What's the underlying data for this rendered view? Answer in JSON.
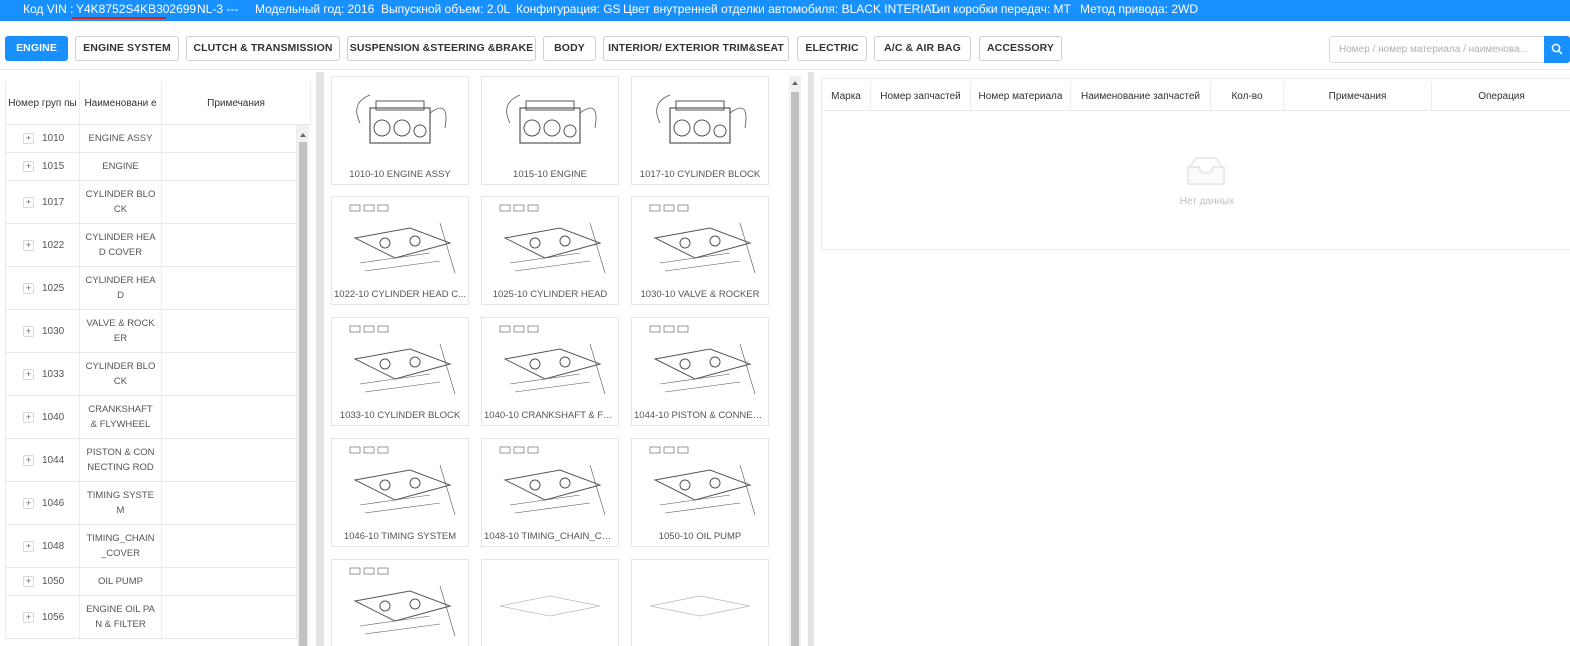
{
  "info_bar": {
    "vin_label": "Код VIN :",
    "vin": "Y4K8752S4KB302699",
    "model_code": "NL-3 ---",
    "model_year": "Модельный год: 2016",
    "displacement": "Выпускной объем: 2.0L",
    "configuration": "Конфигурация: GS",
    "interior_color": "Цвет внутренней отделки автомобиля: BLACK INTERIAL",
    "transmission": "Тип коробки передач: MT",
    "drive": "Метод привода: 2WD"
  },
  "tabs": [
    {
      "label": "ENGINE",
      "active": true
    },
    {
      "label": "ENGINE SYSTEM"
    },
    {
      "label": "CLUTCH & TRANSMISSION"
    },
    {
      "label": "SUSPENSION &STEERING &BRAKE"
    },
    {
      "label": "BODY"
    },
    {
      "label": "INTERIOR/ EXTERIOR TRIM&SEAT"
    },
    {
      "label": "ELECTRIC"
    },
    {
      "label": "A/C & AIR BAG"
    },
    {
      "label": "ACCESSORY"
    }
  ],
  "search": {
    "placeholder": "Номер / номер материала / наименова..."
  },
  "groups": {
    "columns": [
      "Номер груп пы",
      "Наименовани е",
      "Примечания"
    ],
    "rows": [
      {
        "code": "1010",
        "name": "ENGINE ASSY"
      },
      {
        "code": "1015",
        "name": "ENGINE"
      },
      {
        "code": "1017",
        "name": "CYLINDER BLO CK"
      },
      {
        "code": "1022",
        "name": "CYLINDER HEA D COVER"
      },
      {
        "code": "1025",
        "name": "CYLINDER HEA D"
      },
      {
        "code": "1030",
        "name": "VALVE & ROCK ER"
      },
      {
        "code": "1033",
        "name": "CYLINDER BLO CK"
      },
      {
        "code": "1040",
        "name": "CRANKSHAFT & FLYWHEEL"
      },
      {
        "code": "1044",
        "name": "PISTON & CON NECTING ROD"
      },
      {
        "code": "1046",
        "name": "TIMING SYSTE M"
      },
      {
        "code": "1048",
        "name": "TIMING_CHAIN _COVER"
      },
      {
        "code": "1050",
        "name": "OIL PUMP"
      },
      {
        "code": "1056",
        "name": "ENGINE OIL PA N & FILTER"
      }
    ]
  },
  "diagrams": [
    {
      "caption": "1010-10 ENGINE ASSY",
      "icon": "engine-assembly-diagram"
    },
    {
      "caption": "1015-10 ENGINE",
      "icon": "engine-diagram"
    },
    {
      "caption": "1017-10 CYLINDER BLOCK",
      "icon": "cylinder-block-diagram"
    },
    {
      "caption": "1022-10 CYLINDER HEAD C...",
      "icon": "cylinder-head-cover-diagram"
    },
    {
      "caption": "1025-10 CYLINDER HEAD",
      "icon": "cylinder-head-diagram"
    },
    {
      "caption": "1030-10 VALVE & ROCKER",
      "icon": "valve-rocker-diagram"
    },
    {
      "caption": "1033-10 CYLINDER BLOCK",
      "icon": "cylinder-block-exploded-diagram"
    },
    {
      "caption": "1040-10 CRANKSHAFT & FL...",
      "icon": "crankshaft-diagram"
    },
    {
      "caption": "1044-10 PISTON & CONNEC...",
      "icon": "piston-diagram"
    },
    {
      "caption": "1046-10 TIMING SYSTEM",
      "icon": "timing-system-diagram"
    },
    {
      "caption": "1048-10 TIMING_CHAIN_CO...",
      "icon": "timing-chain-cover-diagram"
    },
    {
      "caption": "1050-10 OIL PUMP",
      "icon": "oil-pump-diagram"
    },
    {
      "caption": "",
      "icon": "oil-pan-diagram"
    },
    {
      "caption": "",
      "icon": "diagram-partial"
    },
    {
      "caption": "",
      "icon": "diagram-partial"
    }
  ],
  "parts": {
    "columns": [
      "Марка",
      "Номер запчастей",
      "Номер материала",
      "Наименование запчастей",
      "Кол-во",
      "Примечания",
      "Операция"
    ],
    "empty_text": "Нет данных"
  },
  "colors": {
    "accent": "#1890ff",
    "vin_underline": "#e02020"
  }
}
